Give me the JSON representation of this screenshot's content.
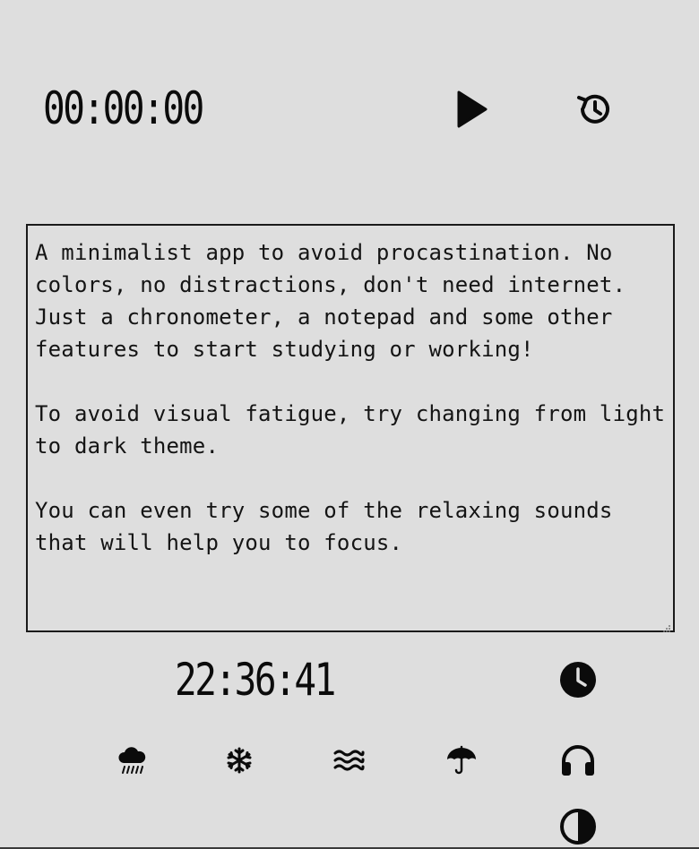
{
  "stopwatch": {
    "time": "00:00:00",
    "play_icon": "play-icon",
    "reset_icon": "history-icon"
  },
  "notepad": {
    "text": "A minimalist app to avoid procastination. No colors, no distractions, don't need internet. Just a chronometer, a notepad and some other features to start studying or working!\n\nTo avoid visual fatigue, try changing from light to dark theme.\n\nYou can even try some of the relaxing sounds that will help you to focus."
  },
  "clock": {
    "time": "22:36:41",
    "alarm_icon": "clock-icon"
  },
  "sounds": [
    {
      "name": "rain",
      "icon": "rain-cloud-icon"
    },
    {
      "name": "snow",
      "icon": "snowflake-icon"
    },
    {
      "name": "waves",
      "icon": "waves-icon"
    },
    {
      "name": "umbrella",
      "icon": "umbrella-icon"
    },
    {
      "name": "headphones",
      "icon": "headphones-icon"
    }
  ],
  "theme": {
    "icon": "contrast-icon"
  },
  "colors": {
    "background": "#dedede",
    "foreground": "#111111",
    "border": "#1a1a1a"
  }
}
